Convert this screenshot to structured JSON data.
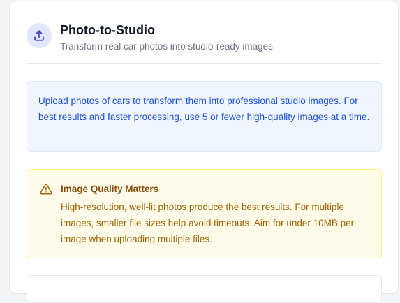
{
  "header": {
    "title": "Photo-to-Studio",
    "subtitle": "Transform real car photos into studio-ready images",
    "icon": "upload-icon",
    "accent_color": "#4f46e5"
  },
  "info": {
    "text": "Upload photos of cars to transform them into professional studio images. For best results and faster processing, use 5 or fewer high-quality images at a time."
  },
  "warning": {
    "icon": "warning-triangle-icon",
    "title": "Image Quality Matters",
    "text": "High-resolution, well-lit photos produce the best results. For multiple images, smaller file sizes help avoid timeouts. Aim for under 10MB per image when uploading multiple files."
  }
}
